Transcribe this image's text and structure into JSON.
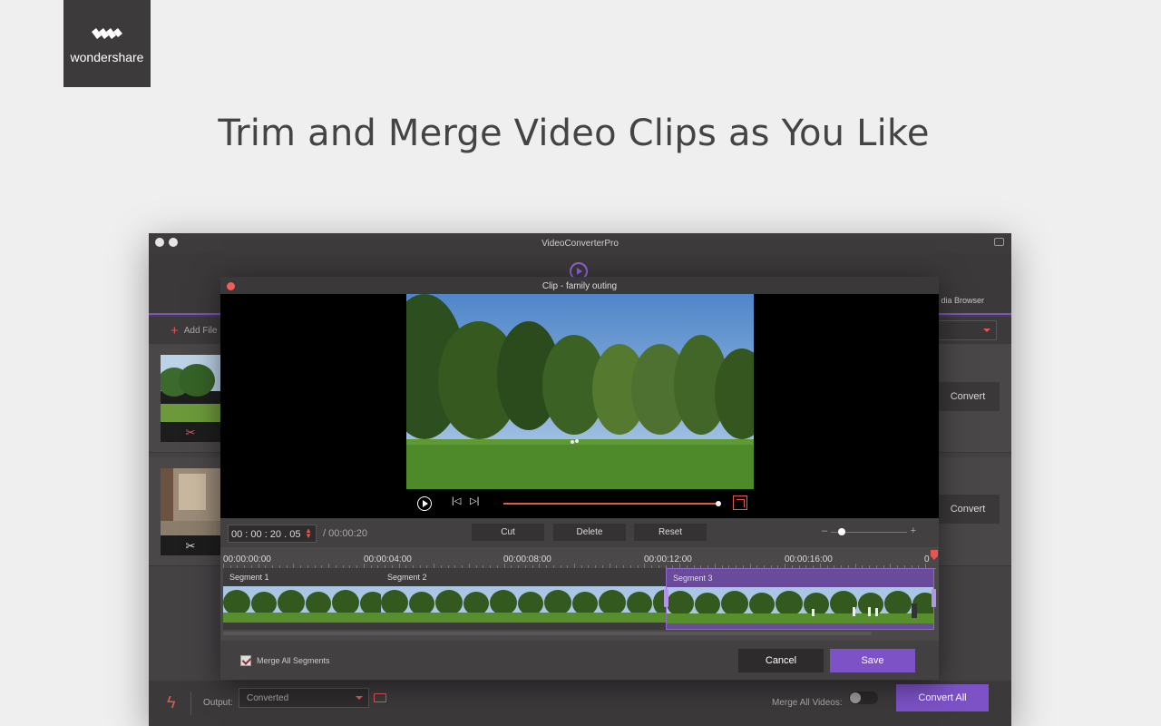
{
  "brand": {
    "name": "wondershare",
    "icon": "wondershare-logo"
  },
  "headline": "Trim and Merge Video Clips as You Like",
  "app": {
    "title": "VideoConverterPro",
    "toolbar": {
      "media_browser": "dia Browser"
    },
    "add_files": "Add File",
    "files": [
      {
        "convert_label": "Convert",
        "scissor_icon": "scissors-icon"
      },
      {
        "convert_label": "Convert",
        "scissor_icon": "scissors-icon"
      }
    ],
    "bottom": {
      "output_label": "Output:",
      "output_value": "Converted",
      "merge_label": "Merge All Videos:",
      "merge_on": false,
      "convert_all": "Convert All"
    }
  },
  "dialog": {
    "title": "Clip - family outing",
    "playback_progress": 1.0,
    "current_time": "00 : 00 : 20 . 05",
    "duration": "/ 00:00:20",
    "buttons": {
      "cut": "Cut",
      "delete": "Delete",
      "reset": "Reset"
    },
    "zoom_level": 0.1,
    "ruler": [
      "00:00:00:00",
      "00:00:04:00",
      "00:00:08:00",
      "00:00:12:00",
      "00:00:16:00",
      "0"
    ],
    "segments": [
      {
        "label": "Segment 1"
      },
      {
        "label": "Segment 2"
      },
      {
        "label": "Segment 3"
      }
    ],
    "merge_segments_label": "Merge All Segments",
    "merge_segments_checked": true,
    "cancel": "Cancel",
    "save": "Save"
  },
  "colors": {
    "accent_purple": "#7d52c7",
    "accent_red": "#e4574f",
    "panel_dark": "#454244"
  }
}
